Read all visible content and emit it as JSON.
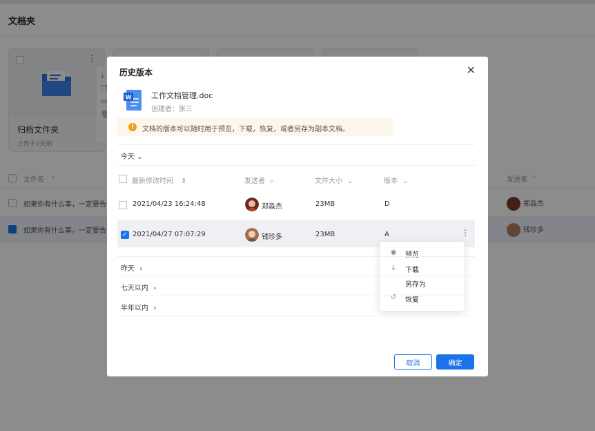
{
  "page": {
    "title": "文档夹",
    "folder_card": {
      "name": "归档文件夹",
      "sub": "上传于7天前"
    },
    "table": {
      "col_filename": "文件名",
      "col_sender": "发送者",
      "rows": [
        {
          "text": "如果你有什么事，一定要告诉",
          "sender": "郑淼杰",
          "checked": false
        },
        {
          "text": "如果你有什么事，一定要告诉",
          "sender": "钱珍多",
          "checked": true
        }
      ]
    }
  },
  "modal": {
    "title": "历史版本",
    "close": "✕",
    "file": {
      "name": "工作文档管理.doc",
      "creator": "创建者：张三"
    },
    "notice": "文档的版本可以随时用于预览，下载，恢复，或者另存为副本文档。",
    "group_today": "今天",
    "columns": {
      "modified": "最新修改时间",
      "sender": "发送者",
      "size": "文件大小",
      "version": "版本"
    },
    "rows": [
      {
        "time": "2021/04/23 16:24:48",
        "sender": "郑淼杰",
        "size": "23MB",
        "version": "D",
        "checked": false
      },
      {
        "time": "2021/04/27 07:07:29",
        "sender": "钱珍多",
        "size": "23MB",
        "version": "A",
        "checked": true
      }
    ],
    "menu": [
      {
        "icon": "eye-icon",
        "label": "预览"
      },
      {
        "icon": "download-icon",
        "label": "下载"
      },
      {
        "icon": "",
        "label": "另存为"
      },
      {
        "icon": "restore-icon",
        "label": "恢复"
      }
    ],
    "groups": [
      "昨天",
      "七天以内",
      "半年以内"
    ],
    "buttons": {
      "cancel": "取消",
      "ok": "确定"
    }
  },
  "colors": {
    "accent": "#1a73e8",
    "warning": "#f0a020",
    "notice_bg": "#fdf6ec"
  }
}
